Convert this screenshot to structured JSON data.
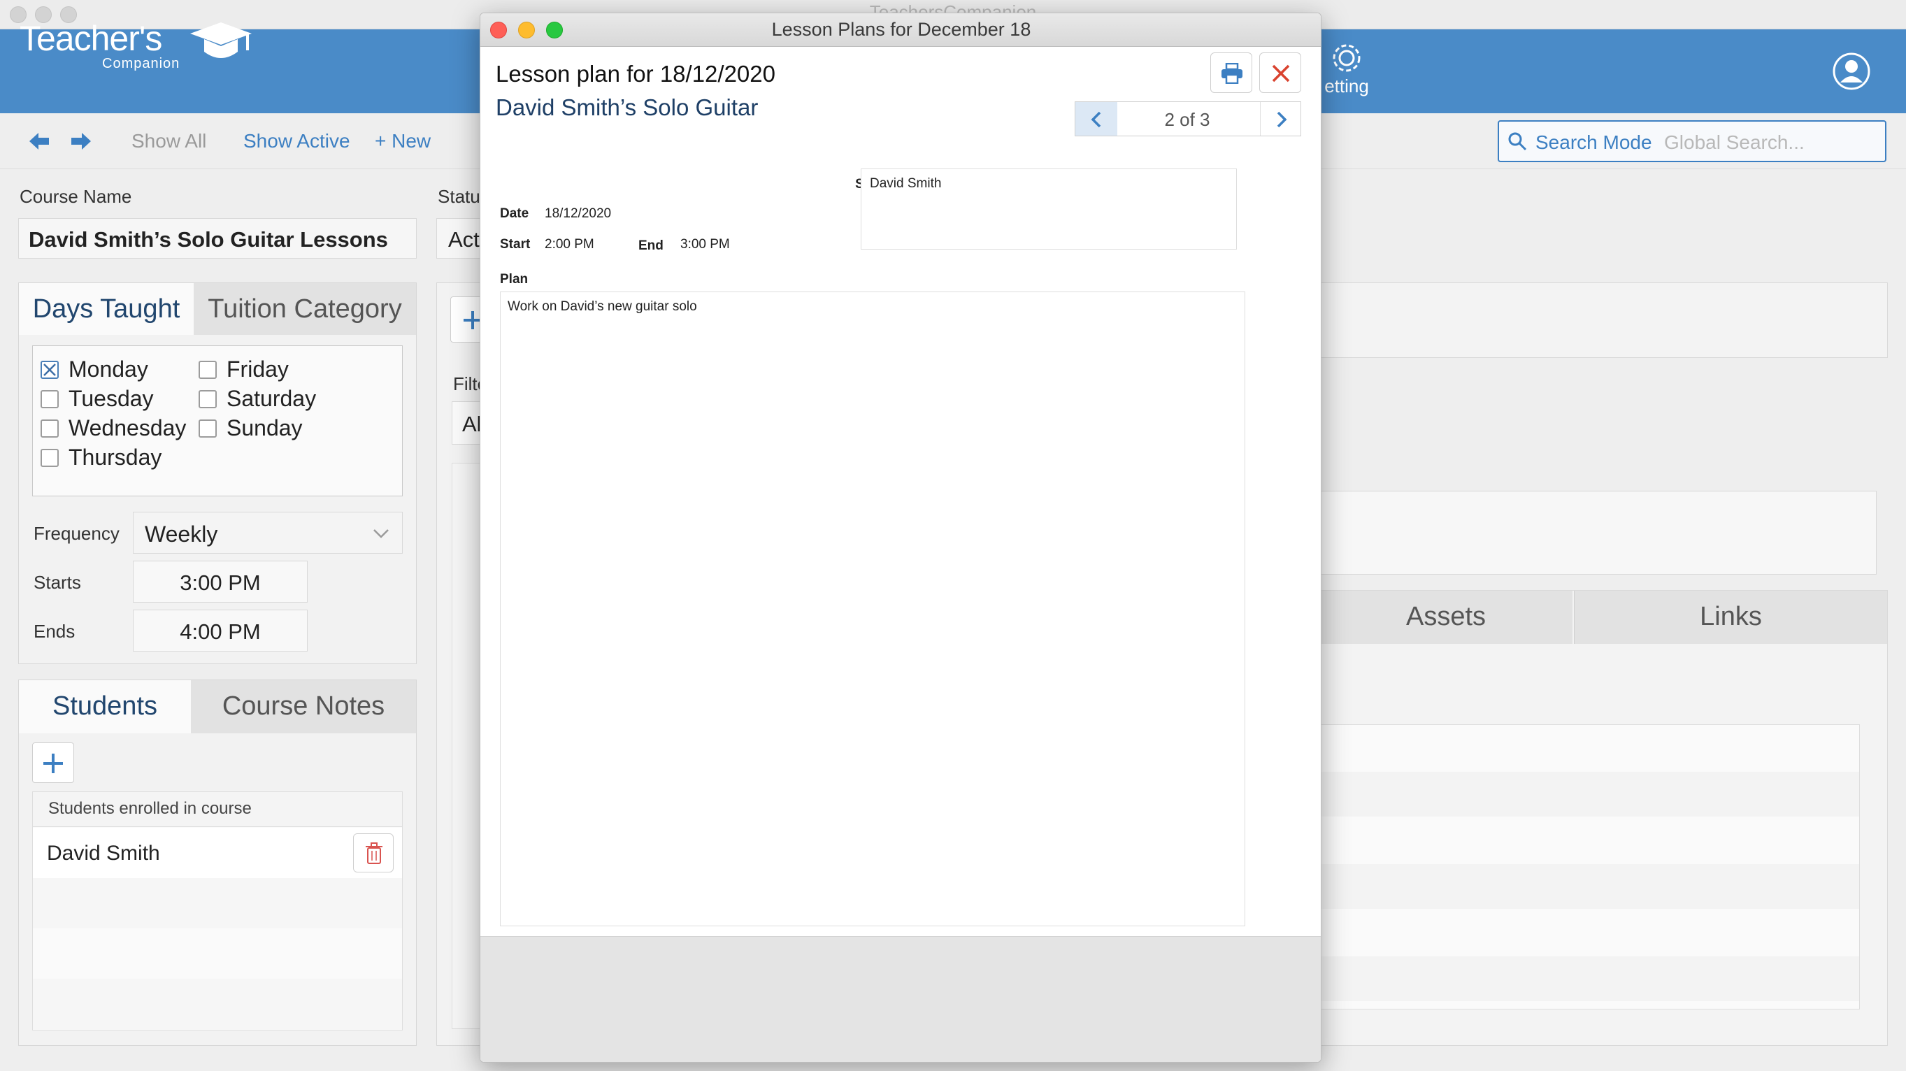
{
  "app": {
    "window_title": "TeachersCompanion",
    "logo_main": "Teacher's",
    "logo_sub": "Companion",
    "settings_label": "etting"
  },
  "toolbar": {
    "show_all": "Show All",
    "show_active": "Show Active",
    "new_label": "+ New"
  },
  "search": {
    "mode": "Search Mode",
    "placeholder": "Global Search..."
  },
  "course": {
    "name_label": "Course Name",
    "name_value": "David Smith’s Solo Guitar Lessons",
    "status_label_partial": "Statu",
    "status_value_partial": "Act"
  },
  "days_panel": {
    "tabs": [
      "Days Taught",
      "Tuition Category"
    ],
    "days": [
      {
        "label": "Monday",
        "checked": true
      },
      {
        "label": "Tuesday",
        "checked": false
      },
      {
        "label": "Wednesday",
        "checked": false
      },
      {
        "label": "Thursday",
        "checked": false
      },
      {
        "label": "Friday",
        "checked": false
      },
      {
        "label": "Saturday",
        "checked": false
      },
      {
        "label": "Sunday",
        "checked": false
      }
    ],
    "frequency_label": "Frequency",
    "frequency_value": "Weekly",
    "starts_label": "Starts",
    "starts_value": "3:00 PM",
    "ends_label": "Ends",
    "ends_value": "4:00 PM"
  },
  "students_panel": {
    "tabs": [
      "Students",
      "Course Notes"
    ],
    "list_header": "Students enrolled in course",
    "students": [
      "David Smith"
    ]
  },
  "middle": {
    "filter_label_partial": "Filte",
    "filter_value_partial": "Al"
  },
  "right_tabs": [
    "Assets",
    "Links"
  ],
  "dialog": {
    "window_title": "Lesson Plans for December 18",
    "heading": "Lesson plan for 18/12/2020",
    "subheading": "David Smith’s Solo Guitar",
    "pager": "2 of 3",
    "students_label": "Student(s)",
    "students_value": "David Smith",
    "date_label": "Date",
    "date_value": "18/12/2020",
    "start_label": "Start",
    "start_value": "2:00 PM",
    "end_label": "End",
    "end_value": "3:00 PM",
    "plan_label": "Plan",
    "plan_value": "Work on David’s new guitar solo"
  },
  "colors": {
    "header_blue": "#4a8bc8",
    "accent_blue": "#3c7fc2",
    "close_red": "#d9422e"
  }
}
